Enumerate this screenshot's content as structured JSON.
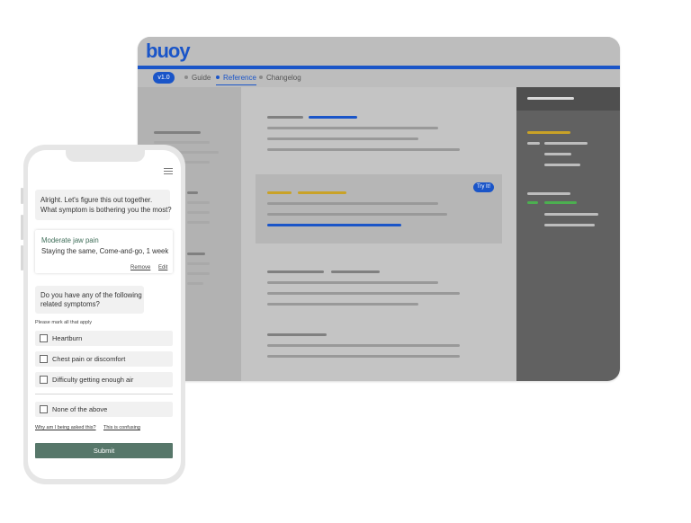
{
  "desktop": {
    "logo": "buoy",
    "version": "v1.0",
    "nav": [
      {
        "label": "Guide"
      },
      {
        "label": "Reference"
      },
      {
        "label": "Changelog"
      }
    ],
    "try_button": "Try It!",
    "colors": {
      "accent": "#1a55c8",
      "highlight": "#c9a227",
      "success": "#4caf50"
    }
  },
  "phone": {
    "question1": {
      "line1": "Alright. Let's figure this out together.",
      "line2": "What symptom is bothering you the most?"
    },
    "answer_card": {
      "title": "Moderate jaw pain",
      "subtitle": "Staying the same, Come-and-go, 1 week",
      "remove": "Remove",
      "edit": "Edit"
    },
    "question2": {
      "line1": "Do you have any of the following",
      "line2": "related symptoms?"
    },
    "instruction": "Please mark all that apply",
    "options": [
      {
        "label": "Heartburn",
        "checked": false
      },
      {
        "label": "Chest pain or discomfort",
        "checked": false
      },
      {
        "label": "Difficulty getting enough air",
        "checked": false
      }
    ],
    "none_option": {
      "label": "None of the above",
      "checked": false
    },
    "links": {
      "why": "Why am I being asked this?",
      "confusing": "This is confusing"
    },
    "submit": "Submit",
    "colors": {
      "primary": "#57776a",
      "title": "#3e6d58"
    }
  }
}
